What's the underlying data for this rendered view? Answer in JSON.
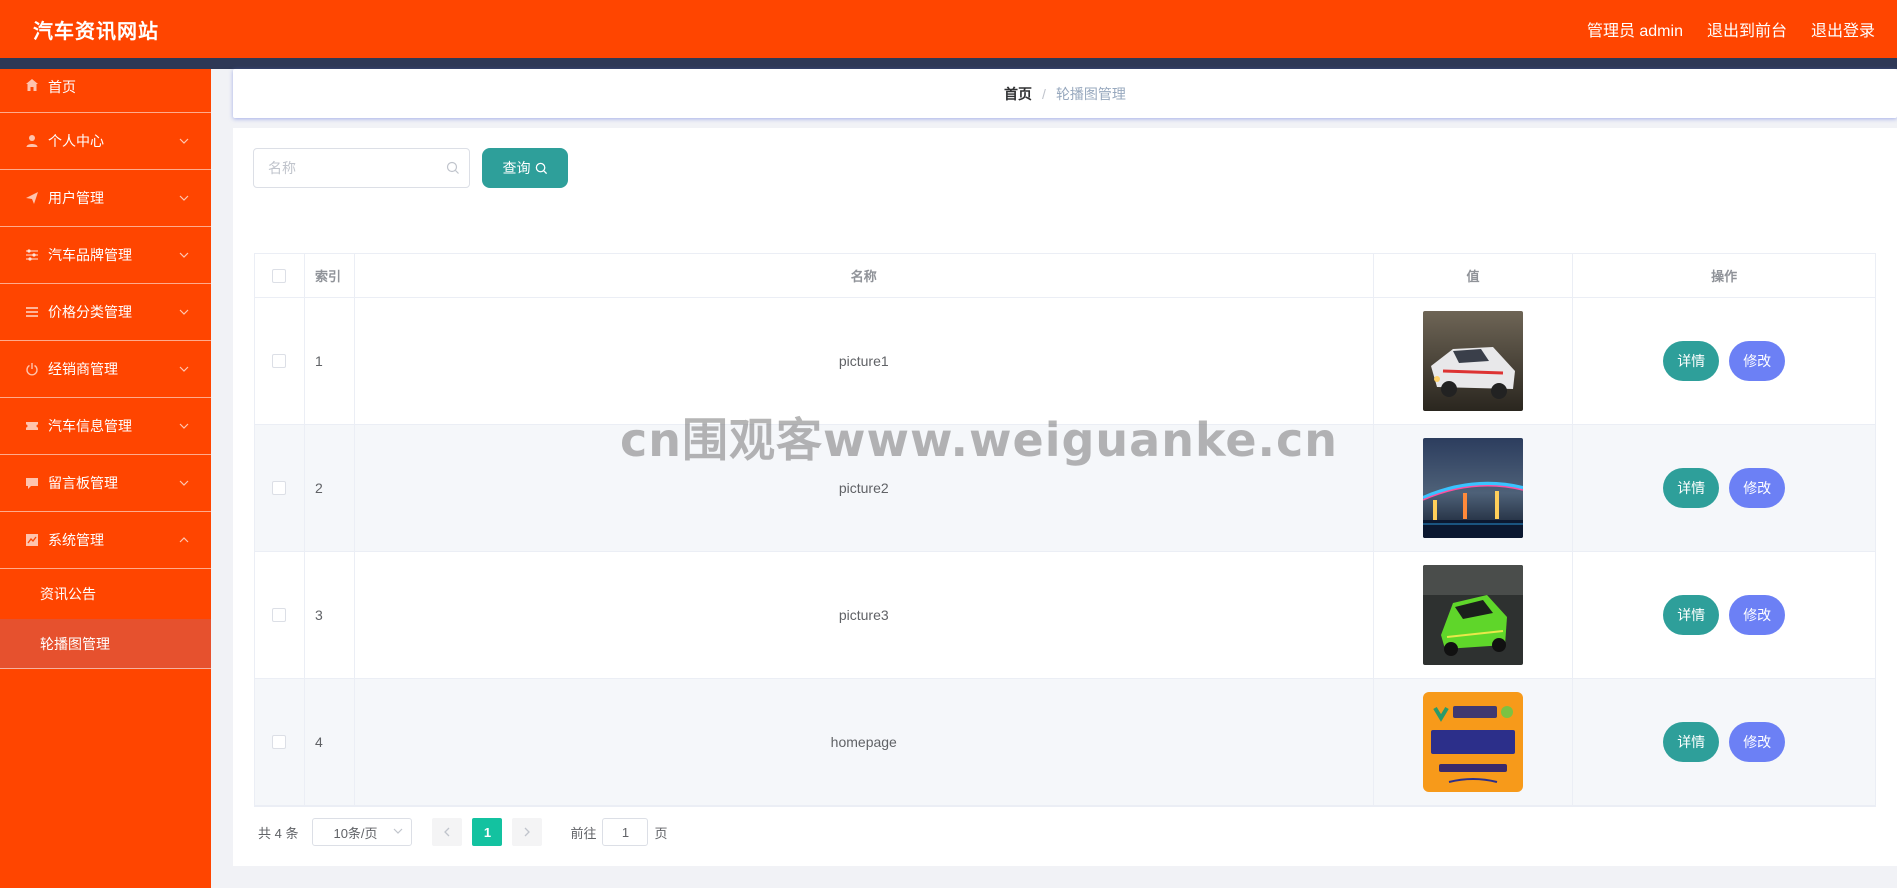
{
  "header": {
    "title": "汽车资讯网站",
    "admin_label": "管理员 admin",
    "to_front": "退出到前台",
    "logout": "退出登录"
  },
  "sidebar": {
    "items": [
      {
        "label": "首页",
        "icon": "home-icon"
      },
      {
        "label": "个人中心",
        "icon": "user-icon"
      },
      {
        "label": "用户管理",
        "icon": "send-icon"
      },
      {
        "label": "汽车品牌管理",
        "icon": "sliders-icon"
      },
      {
        "label": "价格分类管理",
        "icon": "list-icon"
      },
      {
        "label": "经销商管理",
        "icon": "power-icon"
      },
      {
        "label": "汽车信息管理",
        "icon": "ticket-icon"
      },
      {
        "label": "留言板管理",
        "icon": "chat-icon"
      },
      {
        "label": "系统管理",
        "icon": "chart-icon"
      }
    ],
    "sub_items": [
      {
        "label": "资讯公告"
      },
      {
        "label": "轮播图管理"
      }
    ]
  },
  "breadcrumb": {
    "home": "首页",
    "separator": "/",
    "current": "轮播图管理"
  },
  "search": {
    "placeholder": "名称",
    "button_label": "查询"
  },
  "table": {
    "columns": [
      "索引",
      "名称",
      "值",
      "操作"
    ],
    "rows": [
      {
        "index": "1",
        "name": "picture1",
        "thumb": "race-car-image"
      },
      {
        "index": "2",
        "name": "picture2",
        "thumb": "night-bridge-image"
      },
      {
        "index": "3",
        "name": "picture3",
        "thumb": "green-car-image"
      },
      {
        "index": "4",
        "name": "homepage",
        "thumb": "java-logo-image"
      }
    ],
    "detail_label": "详情",
    "edit_label": "修改"
  },
  "pagination": {
    "total": "共 4 条",
    "page_size": "10条/页",
    "current_page": "1",
    "goto_prefix": "前往",
    "goto_value": "1",
    "goto_suffix": "页"
  },
  "watermark": "cn围观客www.weiguanke.cn",
  "colors": {
    "primary": "#ff4500",
    "strip": "#2e3856",
    "teal": "#2e9f9a",
    "blue": "#6c80f5"
  }
}
